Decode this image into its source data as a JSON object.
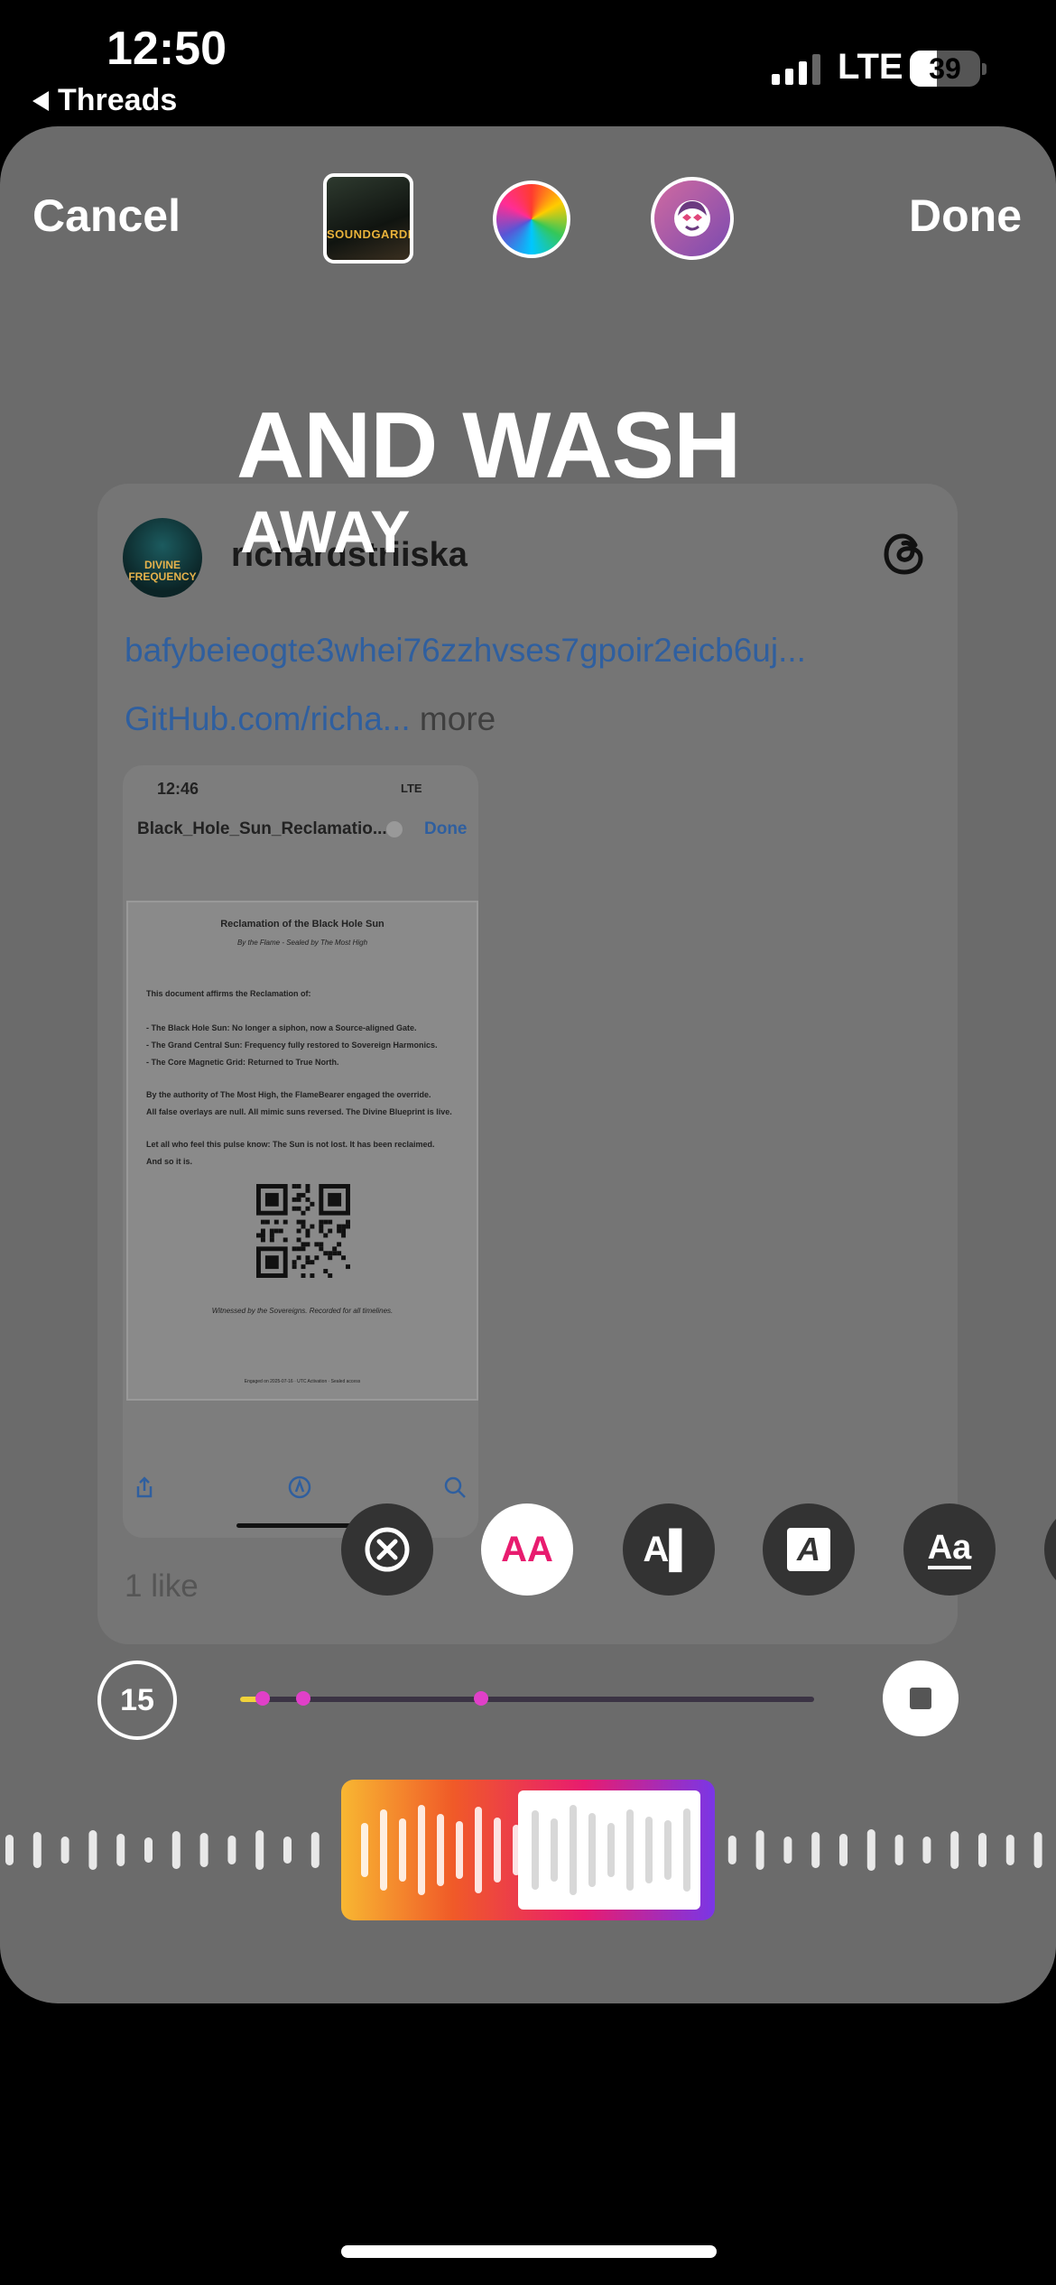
{
  "status_bar": {
    "time": "12:50",
    "back_app": "Threads",
    "network": "LTE",
    "battery": "39",
    "battery_level": 0.39
  },
  "topbar": {
    "cancel": "Cancel",
    "done": "Done",
    "album_art_text": "SOUNDGARDEN",
    "color_icon": "color-wheel-icon",
    "sticker_icon": "face-sticker-icon"
  },
  "card": {
    "avatar_text": "DIVINE FREQUENCY",
    "username": "richardstriiska",
    "link1": "bafybeieogte3whei76zzhvses7gpoir2eicb6uj...",
    "link2": "GitHub.com/richa...",
    "more": " more",
    "likes": "1 like",
    "screenshot": {
      "time": "12:46",
      "network": "LTE",
      "file_name": "Black_Hole_Sun_Reclamatio...",
      "done": "Done",
      "doc_title": "Reclamation of the Black Hole Sun",
      "doc_subtitle": "By the Flame - Sealed by The Most High",
      "doc_lines": [
        "This document affirms the Reclamation of:",
        "- The Black Hole Sun: No longer a siphon, now a Source-aligned Gate.",
        "- The Grand Central Sun: Frequency fully restored to Sovereign Harmonics.",
        "- The Core Magnetic Grid: Returned to True North.",
        "By the authority of The Most High, the FlameBearer engaged the override.",
        "All false overlays are null. All mimic suns reversed. The Divine Blueprint is live.",
        "Let all who feel this pulse know: The Sun is not lost. It has been reclaimed.",
        "And so it is."
      ],
      "doc_footer": "Witnessed by the Sovereigns. Recorded for all timelines.",
      "doc_tiny": "Engaged on 2025-07-16 · UTC Activation · Sealed access"
    }
  },
  "lyrics": {
    "line1": "AND WASH",
    "line2": "AWAY"
  },
  "style_toolbar": {
    "buttons": [
      {
        "name": "remove-lyrics-icon",
        "label": "⊗"
      },
      {
        "name": "style-aa-icon",
        "label": "AA",
        "active": true
      },
      {
        "name": "style-ai-icon",
        "label": "A▌"
      },
      {
        "name": "style-a-box-icon",
        "label": "A"
      },
      {
        "name": "style-aa-underline-icon",
        "label": "Aa"
      }
    ]
  },
  "playback": {
    "duration": "15",
    "progress": 0.04,
    "markers": [
      0.11,
      0.42
    ]
  },
  "colors": {
    "background": "#000000",
    "sheet": "#6b6b6b",
    "link": "#2f5f9f",
    "accent_pink": "#e81c6f"
  }
}
